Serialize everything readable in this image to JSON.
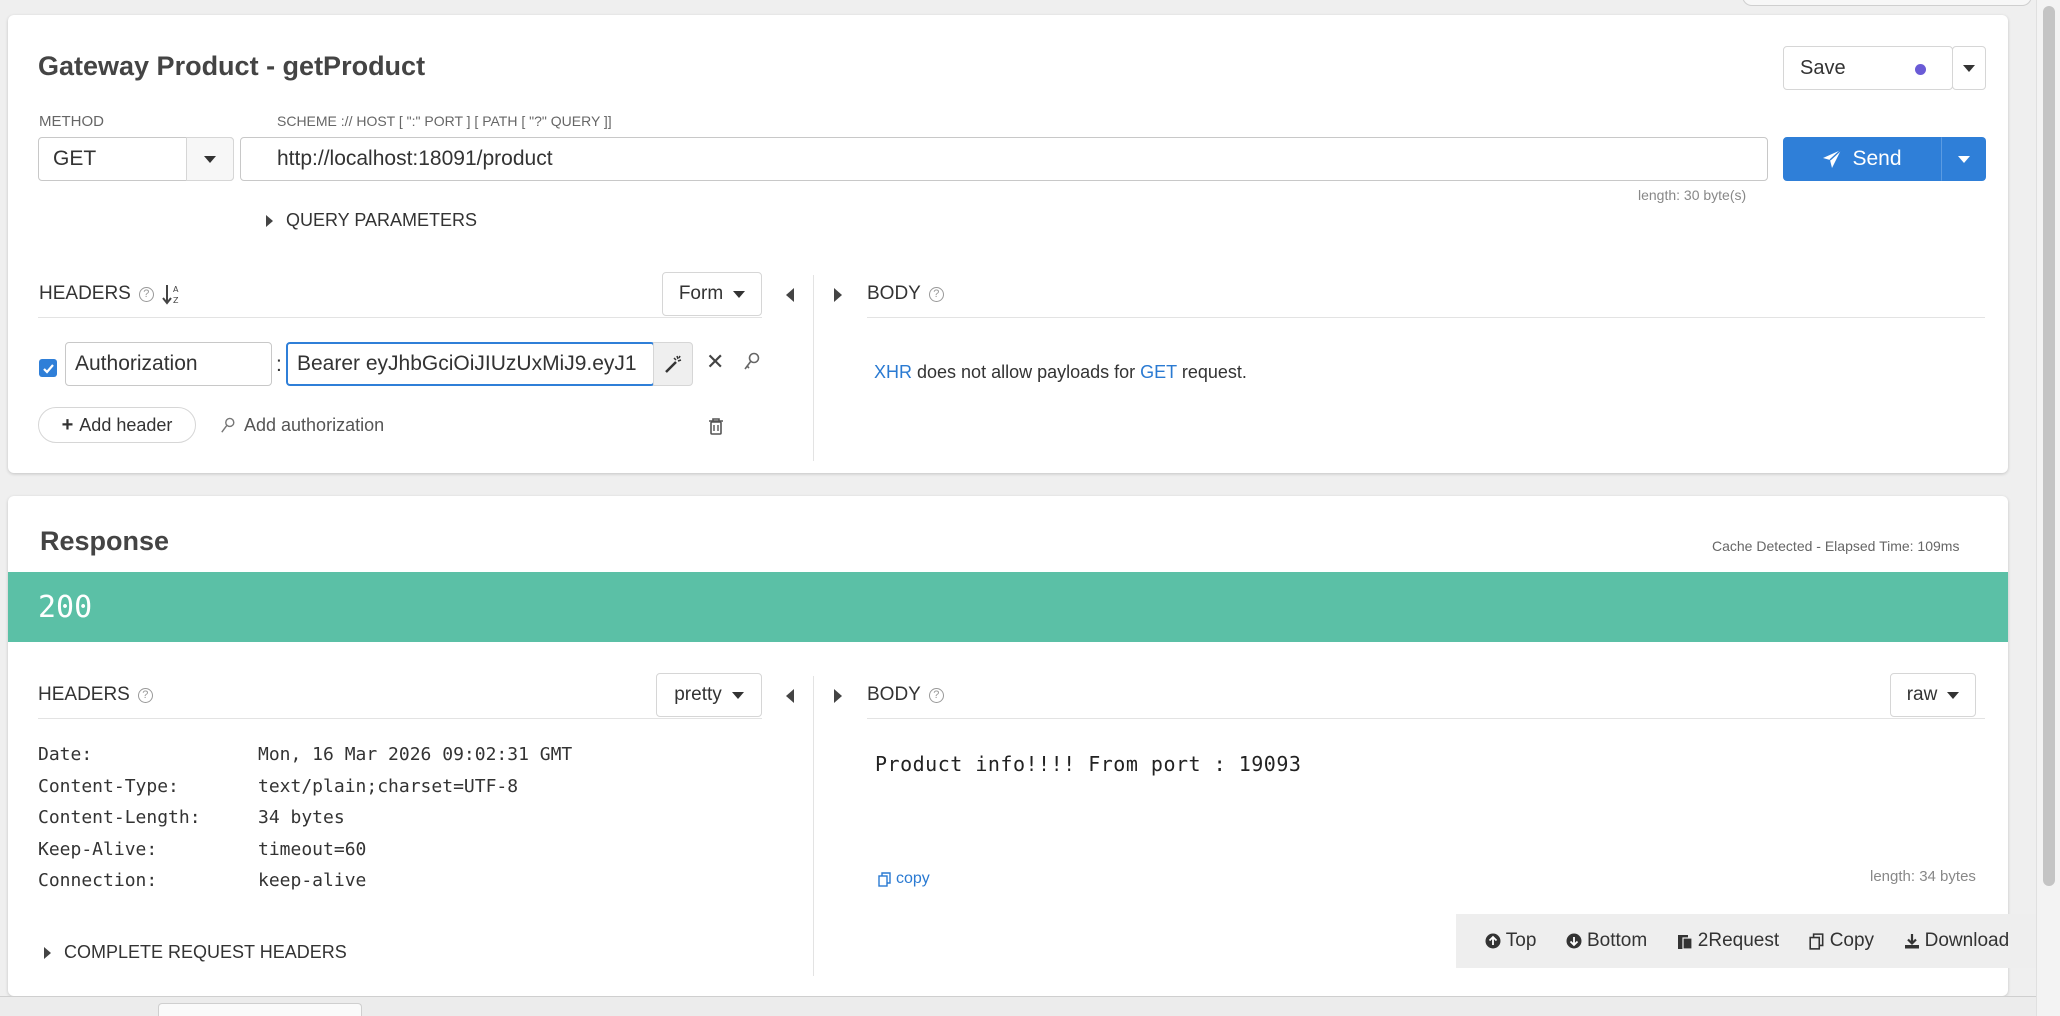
{
  "request": {
    "title": "Gateway Product - getProduct",
    "save_label": "Save",
    "method_label": "METHOD",
    "method_value": "GET",
    "url_label": "SCHEME :// HOST [ \":\" PORT ] [ PATH [ \"?\" QUERY ]]",
    "url_value": "http://localhost:18091/product",
    "url_length": "length: 30 byte(s)",
    "send_label": "Send",
    "query_params_label": "QUERY PARAMETERS",
    "headers_label": "HEADERS",
    "headers_mode": "Form",
    "body_label": "BODY",
    "header_name": "Authorization",
    "header_separator": ":",
    "header_value": "Bearer eyJhbGciOiJIUzUxMiJ9.eyJ1",
    "add_header_label": "Add header",
    "add_auth_label": "Add authorization",
    "body_note": {
      "xhr": "XHR",
      "middle": " does not allow payloads for ",
      "method": "GET",
      "end": " request."
    }
  },
  "response": {
    "title": "Response",
    "cache_info": "Cache Detected - Elapsed Time: 109ms",
    "status_code": "200",
    "status_color": "#5bc0a6",
    "headers_label": "HEADERS",
    "headers_mode": "pretty",
    "body_label": "BODY",
    "body_mode": "raw",
    "headers": [
      {
        "name": "Date:",
        "value": "Mon, 16 Mar 2026 09:02:31 GMT"
      },
      {
        "name": "Content-Type:",
        "value": "text/plain;charset=UTF-8"
      },
      {
        "name": "Content-Length:",
        "value": "34 bytes"
      },
      {
        "name": "Keep-Alive:",
        "value": "timeout=60"
      },
      {
        "name": "Connection:",
        "value": "keep-alive"
      }
    ],
    "body_text": "Product info!!!! From port : 19093",
    "copy_label": "copy",
    "body_length": "length: 34 bytes",
    "complete_headers_label": "COMPLETE REQUEST HEADERS"
  },
  "toolbar": {
    "top": "Top",
    "bottom": "Bottom",
    "to_request": "2Request",
    "copy": "Copy",
    "download": "Download"
  },
  "colors": {
    "accent": "#2f7fd8",
    "status_ok": "#5bc0a6",
    "save_dot": "#6a5bd6"
  }
}
